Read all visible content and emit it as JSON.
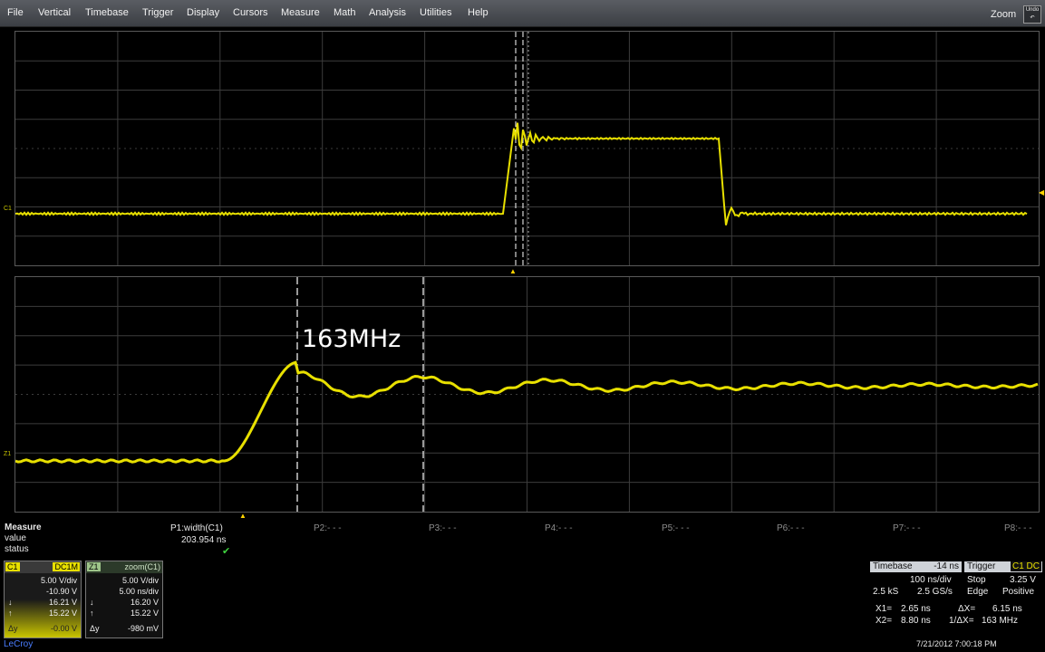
{
  "menu": {
    "items": [
      "File",
      "Vertical",
      "Timebase",
      "Trigger",
      "Display",
      "Cursors",
      "Measure",
      "Math",
      "Analysis",
      "Utilities",
      "Help"
    ],
    "zoom_label": "Zoom",
    "undo_label": "Undo"
  },
  "traces": {
    "upper_channel_tag": "C1",
    "lower_channel_tag": "Z1",
    "trace_color": "#e8e000",
    "frequency_annotation": "163MHz"
  },
  "measure": {
    "title": "Measure",
    "row_value": "value",
    "row_status": "status",
    "p1_label": "P1:width(C1)",
    "p1_value": "203.954 ns",
    "p1_status": "✔",
    "params": [
      "P2:- - -",
      "P3:- - -",
      "P4:- - -",
      "P5:- - -",
      "P6:- - -",
      "P7:- - -",
      "P8:- - -"
    ]
  },
  "c1_descriptor": {
    "tag": "C1",
    "coupling": "DC1M",
    "scale": "5.00 V/div",
    "offset": "-10.90 V",
    "cursor1": "16.21 V",
    "cursor2": "15.22 V",
    "delta_sym": "Δy",
    "delta": "-0.00 V",
    "header_color": "#e8e000"
  },
  "z1_descriptor": {
    "tag": "Z1",
    "source": "zoom(C1)",
    "scale": "5.00 V/div",
    "timebase": "5.00 ns/div",
    "cursor1": "16.20 V",
    "cursor2": "15.22 V",
    "delta_sym": "Δy",
    "delta": "-980 mV",
    "header_color": "#9ec48a"
  },
  "timebase": {
    "label": "Timebase",
    "delay": "-14 ns",
    "per_div": "100 ns/div",
    "samples": "2.5 kS",
    "sample_rate": "2.5 GS/s"
  },
  "trigger": {
    "label": "Trigger",
    "channel": "C1 DC",
    "mode": "Stop",
    "level": "3.25 V",
    "type": "Edge",
    "slope": "Positive"
  },
  "cursors": {
    "x1_label": "X1=",
    "x1_value": "2.65 ns",
    "dx_label": "ΔX=",
    "dx_value": "6.15 ns",
    "x2_label": "X2=",
    "x2_value": "8.80 ns",
    "inv_dx_label": "1/ΔX=",
    "inv_dx_value": "163 MHz"
  },
  "footer": {
    "brand": "LeCroy",
    "timestamp": "7/21/2012 7:00:18 PM"
  }
}
